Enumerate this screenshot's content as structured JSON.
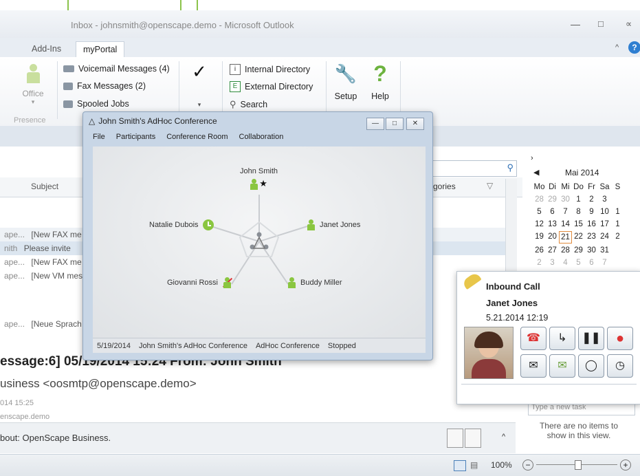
{
  "window": {
    "title": "Inbox - johnsmith@openscape.demo - Microsoft Outlook"
  },
  "tabs": [
    {
      "label": "Add-Ins"
    },
    {
      "label": "myPortal"
    }
  ],
  "ribbon": {
    "presence_group": {
      "office_label": "Office",
      "group_label": "Presence"
    },
    "voicemail": "Voicemail Messages (4)",
    "fax": "Fax Messages (2)",
    "spooled": "Spooled Jobs",
    "internal_directory": "Internal Directory",
    "external_directory": "External Directory",
    "search": "Search",
    "setup": "Setup",
    "help": "Help"
  },
  "mail_list": {
    "subject_header": "Subject",
    "categories_header": "tegories",
    "rows": [
      {
        "sender": "ape...",
        "subject": "[New FAX me"
      },
      {
        "sender": "nith",
        "subject": "Please invite"
      },
      {
        "sender": "ape...",
        "subject": "[New FAX me"
      },
      {
        "sender": "ape...",
        "subject": "[New VM mes"
      },
      {
        "sender": "ape...",
        "subject": "[Neue Sprach"
      }
    ]
  },
  "reading": {
    "title": "essage:6] 05/19/2014 15:24 From: John Smith",
    "from": "usiness <oosmtp@openscape.demo>",
    "time": "014 15:25",
    "domain": "enscape.demo",
    "about": "bout: OpenScape Business."
  },
  "calendar": {
    "month": "Mai 2014",
    "weekdays": [
      "Mo",
      "Di",
      "Mi",
      "Do",
      "Fr",
      "Sa",
      "S"
    ],
    "days": [
      [
        "28",
        "29",
        "30",
        "1",
        "2",
        "3",
        ""
      ],
      [
        "5",
        "6",
        "7",
        "8",
        "9",
        "10",
        "1"
      ],
      [
        "12",
        "13",
        "14",
        "15",
        "16",
        "17",
        "1"
      ],
      [
        "19",
        "20",
        "21",
        "22",
        "23",
        "24",
        "2"
      ],
      [
        "26",
        "27",
        "28",
        "29",
        "30",
        "31",
        ""
      ],
      [
        "2",
        "3",
        "4",
        "5",
        "6",
        "7",
        ""
      ]
    ]
  },
  "tasks": {
    "placeholder": "Type a new task",
    "empty": "There are no items to show in this view."
  },
  "conference": {
    "title": "John Smith's AdHoc Conference",
    "menu": [
      "File",
      "Participants",
      "Conference Room",
      "Collaboration"
    ],
    "participants": {
      "host": "John Smith",
      "p1": "Natalie Dubois",
      "p2": "Janet Jones",
      "p3": "Giovanni Rossi",
      "p4": "Buddy Miller"
    },
    "status": {
      "date": "5/19/2014",
      "name": "John Smith's AdHoc Conference",
      "type": "AdHoc Conference",
      "state": "Stopped"
    }
  },
  "call": {
    "heading": "Inbound Call",
    "caller": "Janet Jones",
    "time": "5.21.2014 12:19"
  },
  "statusbar": {
    "zoom": "100%"
  },
  "colors": {
    "accent": "#8bc34a",
    "presence_green": "#8ac640"
  }
}
